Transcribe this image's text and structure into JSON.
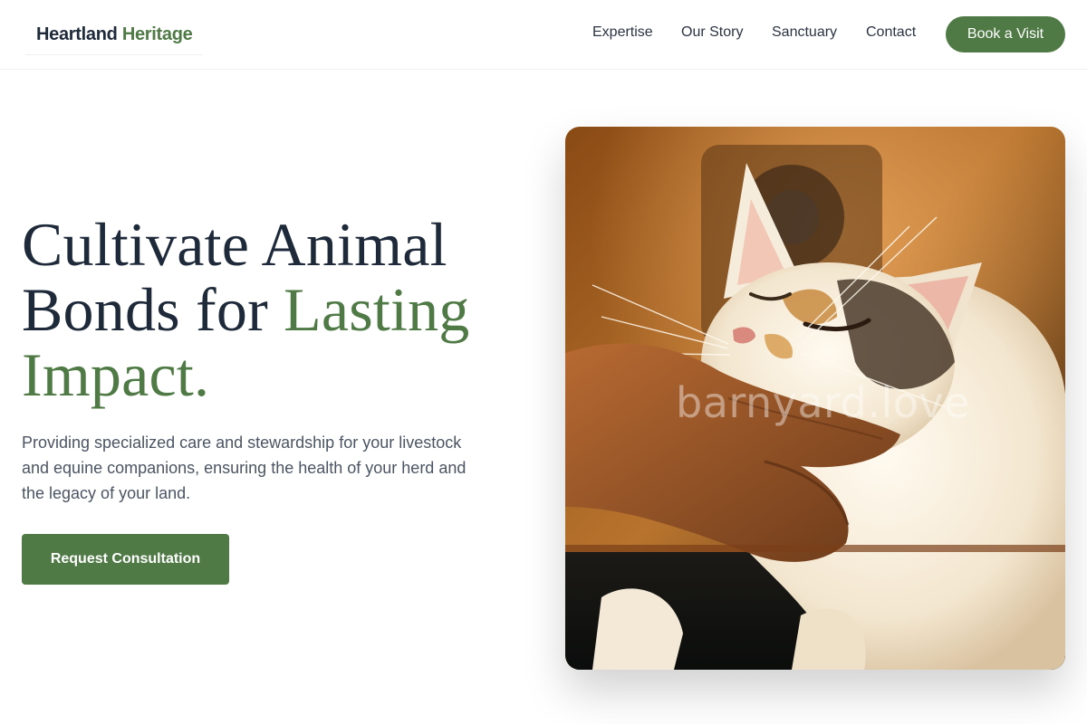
{
  "brand": {
    "name_part1": "Heartland",
    "name_part2": "Heritage"
  },
  "nav": {
    "items": [
      {
        "label": "Expertise"
      },
      {
        "label": "Our Story"
      },
      {
        "label": "Sanctuary"
      },
      {
        "label": "Contact"
      }
    ],
    "cta_label": "Book a Visit"
  },
  "hero": {
    "title_line1": "Cultivate Animal",
    "title_line2_plain": "Bonds for",
    "title_line2_accent": "Lasting",
    "title_line3_accent": "Impact.",
    "subtitle": "Providing specialized care and stewardship for your livestock and equine companions, ensuring the health of your herd and the legacy of your land.",
    "cta_label": "Request Consultation",
    "image_watermark": "barnyard.love"
  },
  "colors": {
    "accent": "#4f7a45",
    "heading": "#1e2a3a",
    "body_text": "#4b5563"
  }
}
